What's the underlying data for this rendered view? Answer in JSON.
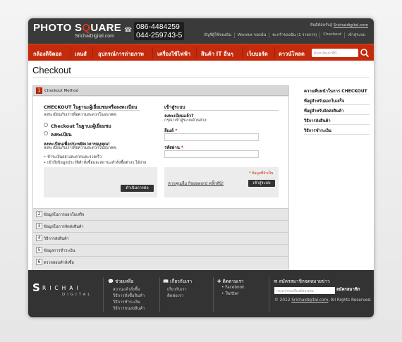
{
  "header": {
    "logo_part1": "PHOTO S",
    "logo_o": "Q",
    "logo_part2": "UARE",
    "logo_sub": "SrichaiDigital.com",
    "phone1": "086-4484259",
    "phone2": "044-259743-5",
    "welcome_prefix": "ยินดีต้อนรับสู่ ",
    "welcome_site": "Srichaidigital.com",
    "links": [
      "บัญชีผู้ใช้ของฉัน",
      "Wishlist ของฉัน",
      "ตะกร้าของฉัน (1 รายการ)",
      "Checkout",
      "เข้าสู่ระบบ"
    ]
  },
  "nav": {
    "items": [
      "กล้องดิจิตอล",
      "เลนส์",
      "อุปกรณ์การถ่ายภาพ",
      "เครื่องใช้ไฟฟ้า",
      "สินค้า IT อื่นๆ",
      "เว็บบอร์ด",
      "ดาวน์โหลด"
    ],
    "search_placeholder": "ค้นหาสินค้าที่นี่..."
  },
  "page_title": "Checkout",
  "checkout": {
    "step1_num": "1",
    "step1_label": "Checkout Method",
    "guest_title": "CHECKOUT ในฐานะผู้เยี่ยมชมหรือลงทะเบียน",
    "guest_sub": "ลงทะเบียนกับเราเพื่อความสะดวกในอนาคต:",
    "opt_guest": "Checkout ในฐานะผู้เยี่ยมชม",
    "opt_register": "ลงทะเบียน",
    "reg_title": "ลงทะเบียนเพื่อประหยัดเวลาของคุณ!",
    "reg_sub": "ลงทะเบียนกับเราเพื่อความสะดวกในอนาคต:",
    "bullet1": "ชำระเงินอย่างสะดวกและรวดเร็ว",
    "bullet2": "เข้าถึงข้อมูลประวัติคำสั่งซื้อและสถานะคำสั่งซื้อต่างๆ ได้ง่าย",
    "continue_btn": "ดำเนินการต่อ",
    "login_title": "เข้าสู่ระบบ",
    "login_q": "ลงทะเบียนแล้ว?",
    "login_sub": "กรุณาเข้าสู่ระบบด้านล่าง:",
    "email_label": "อีเมล์",
    "password_label": "รหัสผ่าน",
    "required_star": "*",
    "required_note": "* ข้อมูลที่จำเป็น",
    "forgot": "หากคุณลืม Password คลิ๊กที่นี่!",
    "login_btn": "เข้าสู่ระบบ",
    "steps": [
      {
        "num": "2",
        "label": "ข้อมูลในการออกใบเสร็จ"
      },
      {
        "num": "3",
        "label": "ข้อมูลในการจัดส่งสินค้า"
      },
      {
        "num": "4",
        "label": "วิธีการส่งสินค้า"
      },
      {
        "num": "5",
        "label": "ข้อมูลการชำระเงิน"
      },
      {
        "num": "6",
        "label": "ตรวจสอบคำสั่งซื้อ"
      }
    ]
  },
  "sidebar": {
    "title": "ความคืบหน้าในการ CHECKOUT",
    "items": [
      "ที่อยู่สำหรับออกใบเสร็จ",
      "ที่อยู่สำหรับจัดส่งสินค้า",
      "วิธีการส่งสินค้า",
      "วิธีการชำระเงิน"
    ]
  },
  "footer": {
    "logo_s": "S",
    "logo_name": "RICHAI",
    "logo_sub": "DIGITAL",
    "help_title": "ช่วยเหลือ",
    "help_items": [
      "สถานะคำสั่งซื้อ",
      "วิธีการสั่งซื้อสินค้า",
      "วิธีการชำระเงิน",
      "วิธีการขนส่งสินค้า"
    ],
    "about_title": "เกี่ยวกับเรา",
    "about_items": [
      "เกี่ยวกับเรา",
      "ติดต่อเรา"
    ],
    "follow_title": "ติดตามเรา",
    "follow_items": [
      "Facebook",
      "Twitter"
    ],
    "news_title": "สมัครสมาชิกจดหมายข่าว",
    "news_placeholder": "กรุณากรอกอีเมล์ของคุณ",
    "news_btn": "สมัครสมาชิก",
    "copy_prefix": "© 2012 ",
    "copy_link": "Srichaidigital.com",
    "copy_suffix": ", All Rights Reserved."
  }
}
